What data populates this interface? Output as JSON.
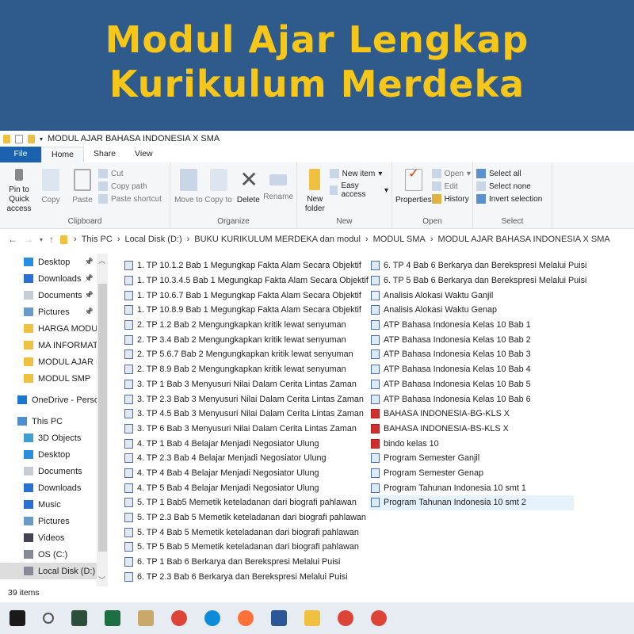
{
  "banner": {
    "line1": "Modul Ajar Lengkap",
    "line2": "Kurikulum Merdeka"
  },
  "window": {
    "title": "MODUL AJAR BAHASA INDONESIA X SMA"
  },
  "tabs": [
    "File",
    "Home",
    "Share",
    "View"
  ],
  "ribbon": {
    "clipboard": {
      "label": "Clipboard",
      "pin": "Pin to Quick access",
      "copy": "Copy",
      "paste": "Paste",
      "cut": "Cut",
      "copy_path": "Copy path",
      "paste_shortcut": "Paste shortcut"
    },
    "organize": {
      "label": "Organize",
      "move_to": "Move to",
      "copy_to": "Copy to",
      "delete": "Delete",
      "rename": "Rename"
    },
    "new": {
      "label": "New",
      "new_folder": "New folder",
      "new_item": "New item",
      "easy_access": "Easy access"
    },
    "open": {
      "label": "Open",
      "properties": "Properties",
      "open": "Open",
      "edit": "Edit",
      "history": "History"
    },
    "select": {
      "label": "Select",
      "select_all": "Select all",
      "select_none": "Select none",
      "invert": "Invert selection"
    }
  },
  "breadcrumb": [
    "This PC",
    "Local Disk (D:)",
    "BUKU KURIKULUM MERDEKA dan modul",
    "MODUL SMA",
    "MODUL AJAR BAHASA INDONESIA X SMA"
  ],
  "nav": [
    {
      "label": "Desktop",
      "icon": "desktop-icon",
      "pin": true
    },
    {
      "label": "Downloads",
      "icon": "download-icon",
      "pin": true
    },
    {
      "label": "Documents",
      "icon": "documents-icon",
      "pin": true
    },
    {
      "label": "Pictures",
      "icon": "pictures-icon",
      "pin": true
    },
    {
      "label": "HARGA MODUL",
      "icon": "folder-icon"
    },
    {
      "label": "MA INFORMATIKA",
      "icon": "folder-icon"
    },
    {
      "label": "MODUL AJAR B.",
      "icon": "folder-icon"
    },
    {
      "label": "MODUL SMP",
      "icon": "folder-icon"
    },
    {
      "label": "OneDrive - Personal",
      "icon": "onedrive-icon",
      "top": true
    },
    {
      "label": "This PC",
      "icon": "pc-icon",
      "top": true
    },
    {
      "label": "3D Objects",
      "icon": "3d-objects-icon"
    },
    {
      "label": "Desktop",
      "icon": "desktop-icon"
    },
    {
      "label": "Documents",
      "icon": "documents-icon"
    },
    {
      "label": "Downloads",
      "icon": "download-icon"
    },
    {
      "label": "Music",
      "icon": "music-icon"
    },
    {
      "label": "Pictures",
      "icon": "pictures-icon"
    },
    {
      "label": "Videos",
      "icon": "videos-icon"
    },
    {
      "label": "OS (C:)",
      "icon": "drive-icon"
    },
    {
      "label": "Local Disk (D:)",
      "icon": "drive-icon",
      "selected": true
    }
  ],
  "files": [
    {
      "name": "1. TP 10.1.2  Bab 1 Megungkap Fakta Alam Secara Objektif",
      "type": "word"
    },
    {
      "name": "1. TP 10.3.4.5  Bab 1 Megungkap Fakta Alam Secara Objektif",
      "type": "word"
    },
    {
      "name": "1. TP 10.6.7  Bab 1 Megungkap Fakta Alam Secara Objektif",
      "type": "word"
    },
    {
      "name": "1. TP 10.8.9  Bab 1 Megungkap Fakta Alam Secara Objektif",
      "type": "word"
    },
    {
      "name": "2. TP 1.2 Bab 2 Mengungkapkan kritik lewat senyuman",
      "type": "word"
    },
    {
      "name": "2. TP 3.4  Bab 2 Mengungkapkan kritik lewat senyuman",
      "type": "word"
    },
    {
      "name": "2. TP 5.6.7 Bab 2 Mengungkapkan kritik lewat senyuman",
      "type": "word"
    },
    {
      "name": "2. TP 8.9 Bab 2 Mengungkapkan kritik lewat senyuman",
      "type": "word"
    },
    {
      "name": "3. TP 1  Bab 3 Menyusuri Nilai Dalam Cerita Lintas Zaman",
      "type": "word"
    },
    {
      "name": "3. TP 2.3  Bab 3 Menyusuri Nilai Dalam Cerita Lintas Zaman",
      "type": "word"
    },
    {
      "name": "3. TP 4.5  Bab 3 Menyusuri Nilai Dalam Cerita Lintas Zaman",
      "type": "word"
    },
    {
      "name": "3. TP 6  Bab 3 Menyusuri Nilai Dalam Cerita Lintas Zaman",
      "type": "word"
    },
    {
      "name": "4. TP 1  Bab 4 Belajar Menjadi Negosiator Ulung",
      "type": "word"
    },
    {
      "name": "4. TP 2.3  Bab 4 Belajar Menjadi Negosiator Ulung",
      "type": "word"
    },
    {
      "name": "4. TP 4  Bab 4 Belajar Menjadi Negosiator Ulung",
      "type": "word"
    },
    {
      "name": "4. TP 5  Bab 4 Belajar Menjadi Negosiator Ulung",
      "type": "word"
    },
    {
      "name": "5. TP 1  Bab5 Memetik keteladanan dari biografi pahlawan",
      "type": "word"
    },
    {
      "name": "5. TP 2.3  Bab 5 Memetik keteladanan dari biografi pahlawan",
      "type": "word"
    },
    {
      "name": "5. TP 4  Bab 5 Memetik keteladanan dari biografi pahlawan",
      "type": "word"
    },
    {
      "name": "5. TP 5  Bab 5 Memetik keteladanan dari biografi pahlawan",
      "type": "word"
    },
    {
      "name": "6. TP 1 Bab 6 Berkarya dan Berekspresi Melalui Puisi",
      "type": "word"
    },
    {
      "name": "6. TP 2.3 Bab 6 Berkarya dan Berekspresi Melalui Puisi",
      "type": "word"
    },
    {
      "name": "6. TP 4 Bab 6 Berkarya dan Berekspresi Melalui Puisi",
      "type": "word"
    },
    {
      "name": "6. TP 5 Bab 6 Berkarya dan Berekspresi Melalui Puisi",
      "type": "word"
    },
    {
      "name": "Analisis Alokasi Waktu Ganjil",
      "type": "excel"
    },
    {
      "name": "Analisis Alokasi Waktu Genap",
      "type": "word"
    },
    {
      "name": "ATP Bahasa Indonesia Kelas 10 Bab 1",
      "type": "word"
    },
    {
      "name": "ATP Bahasa Indonesia Kelas 10 Bab 2",
      "type": "word"
    },
    {
      "name": "ATP Bahasa Indonesia Kelas 10 Bab 3",
      "type": "word"
    },
    {
      "name": "ATP Bahasa Indonesia Kelas 10 Bab 4",
      "type": "word"
    },
    {
      "name": "ATP Bahasa Indonesia Kelas 10 Bab 5",
      "type": "word"
    },
    {
      "name": "ATP Bahasa Indonesia Kelas 10 Bab 6",
      "type": "word"
    },
    {
      "name": "BAHASA INDONESIA-BG-KLS X",
      "type": "pdf"
    },
    {
      "name": "BAHASA INDONESIA-BS-KLS X",
      "type": "pdf"
    },
    {
      "name": "bindo kelas 10",
      "type": "pdf"
    },
    {
      "name": "Program Semester Ganjil",
      "type": "word"
    },
    {
      "name": "Program Semester Genap",
      "type": "word"
    },
    {
      "name": "Program Tahunan Indonesia 10 smt 1",
      "type": "word"
    },
    {
      "name": "Program Tahunan Indonesia 10 smt 2",
      "type": "word",
      "selected": true
    }
  ],
  "status": "39 items",
  "taskbar": [
    {
      "icon": "windows-start-icon",
      "color": "#1a1a1a"
    },
    {
      "icon": "search-icon",
      "color": "#555"
    },
    {
      "icon": "app-icon",
      "color": "#2b4f3a"
    },
    {
      "icon": "excel-icon",
      "color": "#1d6f42"
    },
    {
      "icon": "paint-icon",
      "color": "#c9a86a"
    },
    {
      "icon": "chrome-icon",
      "color": "#db4437"
    },
    {
      "icon": "edge-icon",
      "color": "#0f8cd8"
    },
    {
      "icon": "firefox-icon",
      "color": "#ff7139"
    },
    {
      "icon": "word-icon",
      "color": "#2b5797"
    },
    {
      "icon": "file-explorer-icon",
      "color": "#f0c040"
    },
    {
      "icon": "chrome-icon",
      "color": "#db4437"
    },
    {
      "icon": "chrome-icon",
      "color": "#db4437"
    }
  ]
}
